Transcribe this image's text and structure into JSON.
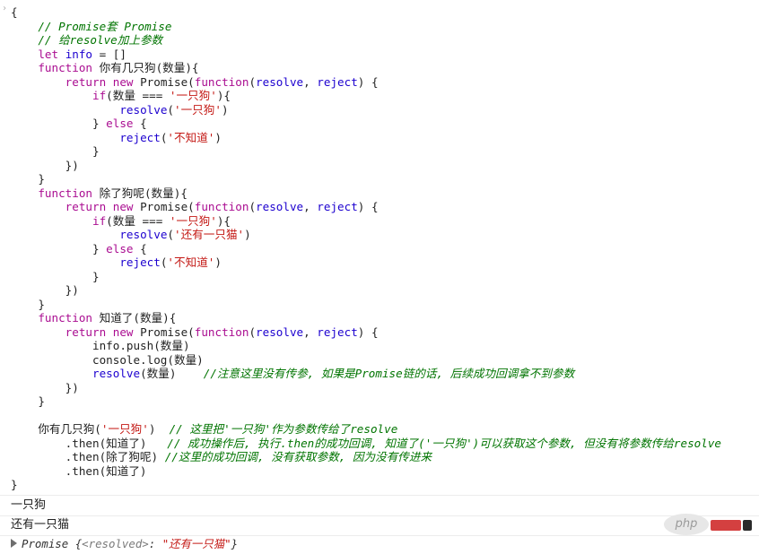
{
  "input": {
    "prompt_glyph": "›",
    "lines": [
      [
        [
          "p",
          "{"
        ]
      ],
      [
        [
          "p",
          "    "
        ],
        [
          "c",
          "// Promise套 Promise"
        ]
      ],
      [
        [
          "p",
          "    "
        ],
        [
          "c",
          "// 给resolve加上参数"
        ]
      ],
      [
        [
          "p",
          "    "
        ],
        [
          "k",
          "let"
        ],
        [
          "p",
          " "
        ],
        [
          "b",
          "info"
        ],
        [
          "p",
          " = []"
        ]
      ],
      [
        [
          "p",
          "    "
        ],
        [
          "k",
          "function"
        ],
        [
          "p",
          " 你有几只狗(数量){"
        ]
      ],
      [
        [
          "p",
          "        "
        ],
        [
          "k",
          "return"
        ],
        [
          "p",
          " "
        ],
        [
          "k",
          "new"
        ],
        [
          "p",
          " Promise("
        ],
        [
          "k",
          "function"
        ],
        [
          "p",
          "("
        ],
        [
          "b",
          "resolve"
        ],
        [
          "p",
          ", "
        ],
        [
          "b",
          "reject"
        ],
        [
          "p",
          ") {"
        ]
      ],
      [
        [
          "p",
          "            "
        ],
        [
          "k",
          "if"
        ],
        [
          "p",
          "(数量 === "
        ],
        [
          "s",
          "'一只狗'"
        ],
        [
          "p",
          "){"
        ]
      ],
      [
        [
          "p",
          "                "
        ],
        [
          "b",
          "resolve"
        ],
        [
          "p",
          "("
        ],
        [
          "s",
          "'一只狗'"
        ],
        [
          "p",
          ")"
        ]
      ],
      [
        [
          "p",
          "            } "
        ],
        [
          "k",
          "else"
        ],
        [
          "p",
          " {"
        ]
      ],
      [
        [
          "p",
          "                "
        ],
        [
          "b",
          "reject"
        ],
        [
          "p",
          "("
        ],
        [
          "s",
          "'不知道'"
        ],
        [
          "p",
          ")"
        ]
      ],
      [
        [
          "p",
          "            }"
        ]
      ],
      [
        [
          "p",
          "        })"
        ]
      ],
      [
        [
          "p",
          "    }"
        ]
      ],
      [
        [
          "p",
          "    "
        ],
        [
          "k",
          "function"
        ],
        [
          "p",
          " 除了狗呢(数量){"
        ]
      ],
      [
        [
          "p",
          "        "
        ],
        [
          "k",
          "return"
        ],
        [
          "p",
          " "
        ],
        [
          "k",
          "new"
        ],
        [
          "p",
          " Promise("
        ],
        [
          "k",
          "function"
        ],
        [
          "p",
          "("
        ],
        [
          "b",
          "resolve"
        ],
        [
          "p",
          ", "
        ],
        [
          "b",
          "reject"
        ],
        [
          "p",
          ") {"
        ]
      ],
      [
        [
          "p",
          "            "
        ],
        [
          "k",
          "if"
        ],
        [
          "p",
          "(数量 === "
        ],
        [
          "s",
          "'一只狗'"
        ],
        [
          "p",
          "){"
        ]
      ],
      [
        [
          "p",
          "                "
        ],
        [
          "b",
          "resolve"
        ],
        [
          "p",
          "("
        ],
        [
          "s",
          "'还有一只猫'"
        ],
        [
          "p",
          ")"
        ]
      ],
      [
        [
          "p",
          "            } "
        ],
        [
          "k",
          "else"
        ],
        [
          "p",
          " {"
        ]
      ],
      [
        [
          "p",
          "                "
        ],
        [
          "b",
          "reject"
        ],
        [
          "p",
          "("
        ],
        [
          "s",
          "'不知道'"
        ],
        [
          "p",
          ")"
        ]
      ],
      [
        [
          "p",
          "            }"
        ]
      ],
      [
        [
          "p",
          "        })"
        ]
      ],
      [
        [
          "p",
          "    }"
        ]
      ],
      [
        [
          "p",
          "    "
        ],
        [
          "k",
          "function"
        ],
        [
          "p",
          " 知道了(数量){"
        ]
      ],
      [
        [
          "p",
          "        "
        ],
        [
          "k",
          "return"
        ],
        [
          "p",
          " "
        ],
        [
          "k",
          "new"
        ],
        [
          "p",
          " Promise("
        ],
        [
          "k",
          "function"
        ],
        [
          "p",
          "("
        ],
        [
          "b",
          "resolve"
        ],
        [
          "p",
          ", "
        ],
        [
          "b",
          "reject"
        ],
        [
          "p",
          ") {"
        ]
      ],
      [
        [
          "p",
          "            info.push(数量)"
        ]
      ],
      [
        [
          "p",
          "            console.log(数量)"
        ]
      ],
      [
        [
          "p",
          "            "
        ],
        [
          "b",
          "resolve"
        ],
        [
          "p",
          "(数量)    "
        ],
        [
          "c",
          "//注意这里没有传参, 如果是Promise链的话, 后续成功回调拿不到参数"
        ]
      ],
      [
        [
          "p",
          "        })"
        ]
      ],
      [
        [
          "p",
          "    }"
        ]
      ],
      [
        [
          "p",
          ""
        ]
      ],
      [
        [
          "p",
          "    你有几只狗("
        ],
        [
          "s",
          "'一只狗'"
        ],
        [
          "p",
          ")  "
        ],
        [
          "c",
          "// 这里把'一只狗'作为参数传给了resolve"
        ]
      ],
      [
        [
          "p",
          "        .then(知道了)   "
        ],
        [
          "c",
          "// 成功操作后, 执行.then的成功回调, 知道了('一只狗')可以获取这个参数, 但没有将参数传给resolve"
        ]
      ],
      [
        [
          "p",
          "        .then(除了狗呢) "
        ],
        [
          "c",
          "//这里的成功回调, 没有获取参数, 因为没有传进来"
        ]
      ],
      [
        [
          "p",
          "        .then(知道了)"
        ]
      ],
      [
        [
          "p",
          "}"
        ]
      ]
    ]
  },
  "logs": {
    "line1": "一只狗",
    "line2": "还有一只猫"
  },
  "result": {
    "name": "Promise ",
    "open": "{",
    "key": "<resolved>",
    "sep": ": ",
    "value": "\"还有一只猫\"",
    "close": "}"
  },
  "watermark": {
    "text": "php"
  },
  "colors": {
    "keyword": "#aa0d91",
    "identifier": "#1c00cf",
    "string": "#c41a16",
    "comment": "#007400",
    "text": "#222222"
  }
}
